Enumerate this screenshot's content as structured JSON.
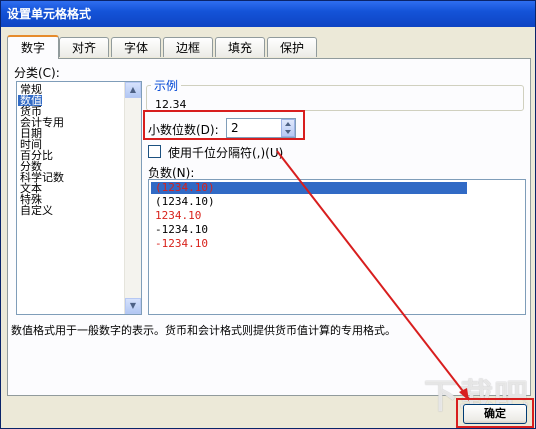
{
  "window": {
    "title": "设置单元格格式"
  },
  "tabs": [
    {
      "label": "数字",
      "active": true
    },
    {
      "label": "对齐"
    },
    {
      "label": "字体"
    },
    {
      "label": "边框"
    },
    {
      "label": "填充"
    },
    {
      "label": "保护"
    }
  ],
  "category": {
    "label": "分类(C):",
    "items": [
      "常规",
      "数值",
      "货币",
      "会计专用",
      "日期",
      "时间",
      "百分比",
      "分数",
      "科学记数",
      "文本",
      "特殊",
      "自定义"
    ],
    "selected": "数值"
  },
  "sample": {
    "group_label": "示例",
    "value": "12.34"
  },
  "decimal": {
    "label": "小数位数(D):",
    "value": "2"
  },
  "thousands": {
    "label": "使用千位分隔符(,)(U)",
    "checked": false
  },
  "negative": {
    "label": "负数(N):",
    "items": [
      {
        "text": "(1234.10)",
        "color": "#d8221b",
        "selected": true
      },
      {
        "text": "(1234.10)",
        "color": "#000000"
      },
      {
        "text": "1234.10",
        "color": "#d8221b"
      },
      {
        "text": "-1234.10",
        "color": "#000000"
      },
      {
        "text": "-1234.10",
        "color": "#d8221b"
      }
    ]
  },
  "description": "数值格式用于一般数字的表示。货币和会计格式则提供货币值计算的专用格式。",
  "ok_button": {
    "label": "确定"
  },
  "watermark": "下载吧",
  "colors": {
    "annotation_red": "#d81e1e",
    "selection_blue": "#316ac5"
  }
}
